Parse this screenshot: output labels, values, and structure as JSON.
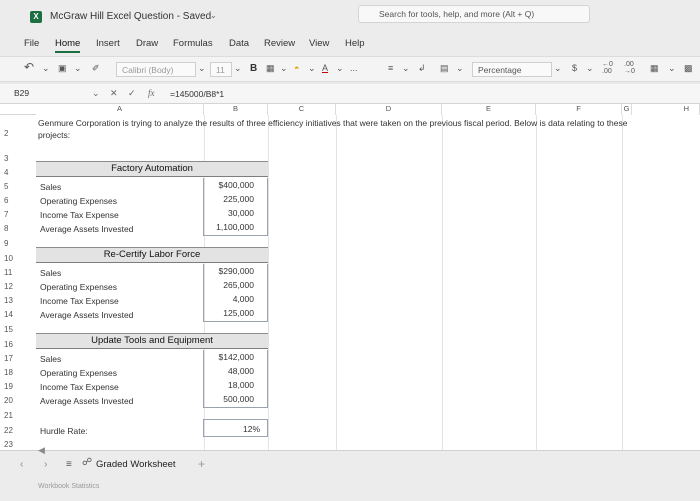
{
  "titlebar": {
    "app_icon_letter": "X",
    "doc_title": "McGraw Hill Excel Question - Saved",
    "search_placeholder": "Search for tools, help, and more (Alt + Q)"
  },
  "menu": {
    "tabs": [
      "File",
      "Home",
      "Insert",
      "Draw",
      "Formulas",
      "Data",
      "Review",
      "View",
      "Help"
    ],
    "active": "Home"
  },
  "ribbon": {
    "undo_icon": "undo-icon",
    "font_name": "Calibri (Body)",
    "font_size": "11",
    "bold_label": "B",
    "more_label": "...",
    "number_format": "Percentage",
    "currency_symbol": "$"
  },
  "formula_bar": {
    "name_box": "B29",
    "fx_label": "fx",
    "formula": "=145000/B8*1"
  },
  "grid": {
    "columns": [
      "A",
      "B",
      "C",
      "D",
      "E",
      "F",
      "G",
      "H"
    ],
    "rows": [
      "2",
      "3",
      "4",
      "5",
      "6",
      "7",
      "8",
      "9",
      "10",
      "11",
      "12",
      "13",
      "14",
      "15",
      "16",
      "17",
      "18",
      "19",
      "20",
      "21",
      "22",
      "23"
    ],
    "intro_text": "Genmure Corporation is trying to analyze the results of three efficiency initiatives that were taken on the previous fiscal period. Below is data relating to these projects:",
    "sections": [
      {
        "title": "Factory Automation",
        "items": [
          {
            "label": "Sales",
            "value": "$400,000"
          },
          {
            "label": "Operating Expenses",
            "value": "225,000"
          },
          {
            "label": "Income Tax Expense",
            "value": "30,000"
          },
          {
            "label": "Average Assets Invested",
            "value": "1,100,000"
          }
        ]
      },
      {
        "title": "Re-Certify Labor Force",
        "items": [
          {
            "label": "Sales",
            "value": "$290,000"
          },
          {
            "label": "Operating Expenses",
            "value": "265,000"
          },
          {
            "label": "Income Tax Expense",
            "value": "4,000"
          },
          {
            "label": "Average Assets Invested",
            "value": "125,000"
          }
        ]
      },
      {
        "title": "Update Tools and Equipment",
        "items": [
          {
            "label": "Sales",
            "value": "$142,000"
          },
          {
            "label": "Operating Expenses",
            "value": "48,000"
          },
          {
            "label": "Income Tax Expense",
            "value": "18,000"
          },
          {
            "label": "Average Assets Invested",
            "value": "500,000"
          }
        ]
      }
    ],
    "hurdle_label": "Hurdle Rate:",
    "hurdle_value": "12%"
  },
  "sheets": {
    "active_sheet": "Graded Worksheet",
    "add_label": "+"
  },
  "status": {
    "text": "Workbook Statistics"
  },
  "colors": {
    "accent": "#1d6f42",
    "section_header_bg": "#e3e3e3"
  }
}
